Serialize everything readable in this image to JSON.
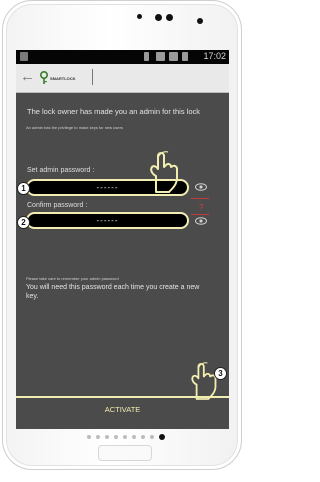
{
  "statusbar": {
    "time": "17:02"
  },
  "appbar": {
    "back_icon": "back-arrow-icon",
    "logo_text": "SMARTLOCK"
  },
  "main": {
    "heading": "The lock owner has made you an admin for this lock",
    "subheading": "An admin has the privilege to make keys for new users",
    "set_password_label": "Set admin password :",
    "set_password_value": "------",
    "confirm_password_label": "Confirm password :",
    "confirm_password_value": "------",
    "mismatch_mark": "?",
    "note_small": "Please take care to remember your admin password",
    "note_large": "You will need this password each time you create a new key."
  },
  "footer": {
    "activate_label": "ACTIVATE"
  },
  "annotations": {
    "step1": "1",
    "step2": "2",
    "step3": "3"
  },
  "pager": {
    "total": 9,
    "active_index": 8
  },
  "colors": {
    "accent": "#f2edb0",
    "screen_bg": "#4b4b4b",
    "error": "#c03c3c"
  }
}
